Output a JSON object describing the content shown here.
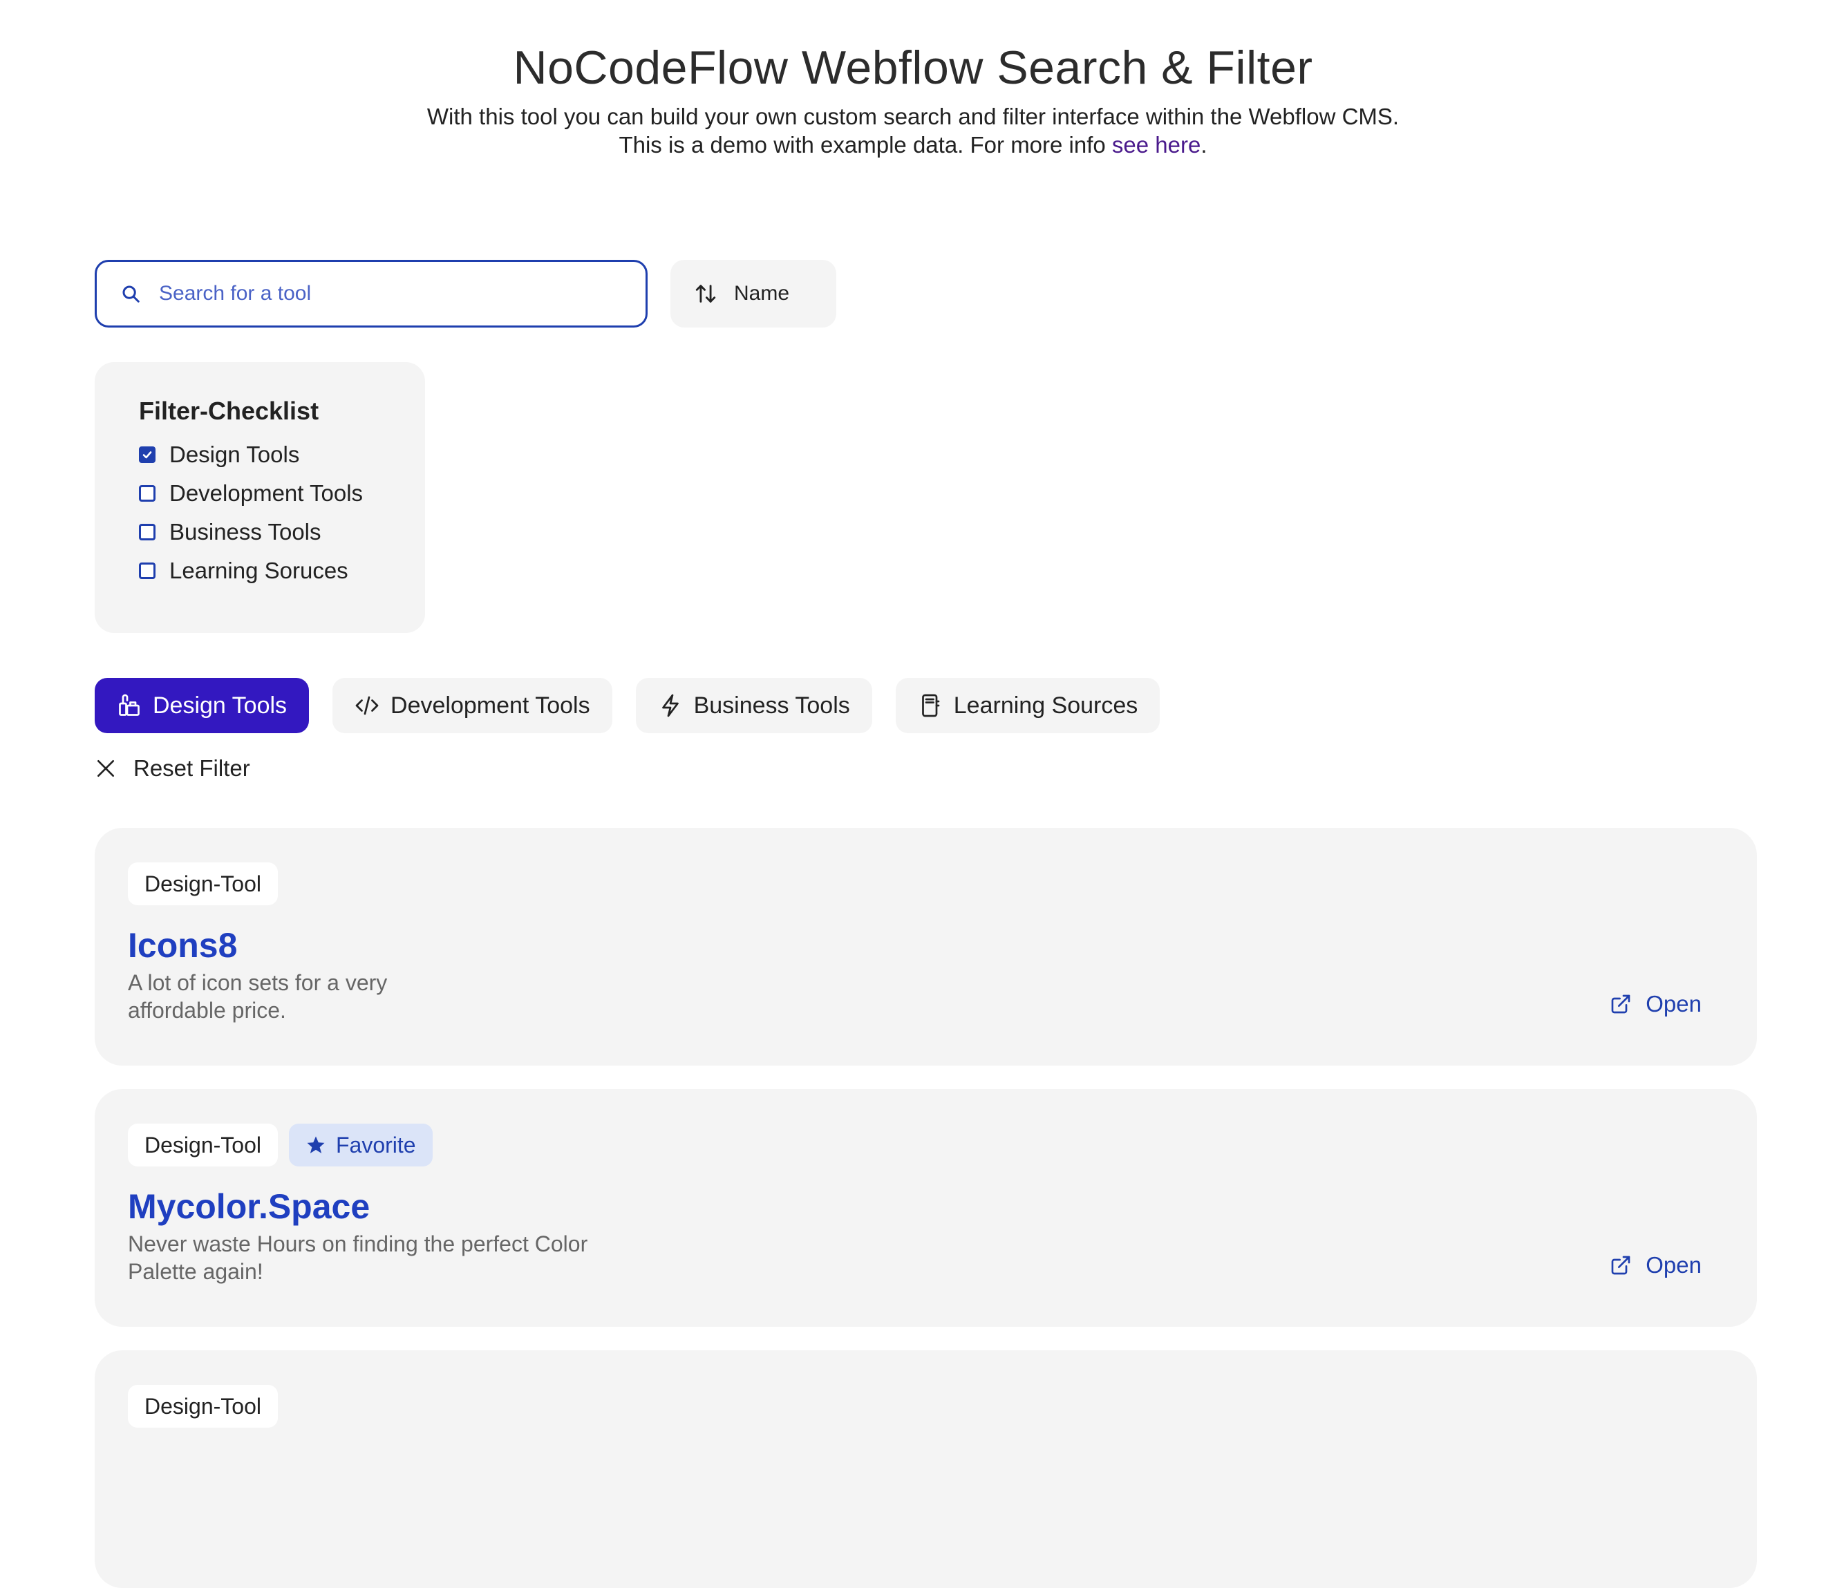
{
  "header": {
    "title": "NoCodeFlow Webflow Search & Filter",
    "subtitle_line1": "With this tool you can build your own custom search and filter interface within the Webflow CMS.",
    "subtitle_line2_prefix": "This is a demo with example data. For more info ",
    "subtitle_link": "see here",
    "subtitle_line2_suffix": "."
  },
  "search": {
    "placeholder": "Search for a tool",
    "value": "",
    "icon": "search-icon"
  },
  "sort": {
    "label": "Name",
    "icon": "sort-arrows-icon"
  },
  "filter_checklist": {
    "title": "Filter-Checklist",
    "items": [
      {
        "label": "Design Tools",
        "checked": true
      },
      {
        "label": "Development Tools",
        "checked": false
      },
      {
        "label": "Business Tools",
        "checked": false
      },
      {
        "label": "Learning Soruces",
        "checked": false
      }
    ]
  },
  "tabs": [
    {
      "label": "Design Tools",
      "icon": "paint-bucket-icon",
      "active": true
    },
    {
      "label": "Development Tools",
      "icon": "code-icon",
      "active": false
    },
    {
      "label": "Business Tools",
      "icon": "lightning-icon",
      "active": false
    },
    {
      "label": "Learning Sources",
      "icon": "notebook-icon",
      "active": false
    }
  ],
  "reset": {
    "label": "Reset Filter",
    "icon": "close-icon"
  },
  "cards": [
    {
      "tags": [
        "Design-Tool"
      ],
      "name": "Icons8",
      "description_line1": "A lot of icon sets for a very",
      "description_line2": "affordable price.",
      "open_label": "Open"
    },
    {
      "tags": [
        "Design-Tool"
      ],
      "favorite_label": "Favorite",
      "name": "Mycolor.Space",
      "description_line1": "Never waste Hours on finding the perfect Color",
      "description_line2": "Palette again!",
      "open_label": "Open"
    },
    {
      "tags": [
        "Design-Tool"
      ]
    }
  ],
  "colors": {
    "accent": "#3318c0",
    "link_blue": "#1f3fc0",
    "panel_gray": "#f4f4f4",
    "favorite_bg": "#dbe4f8",
    "link_purple": "#4a1a8c"
  }
}
